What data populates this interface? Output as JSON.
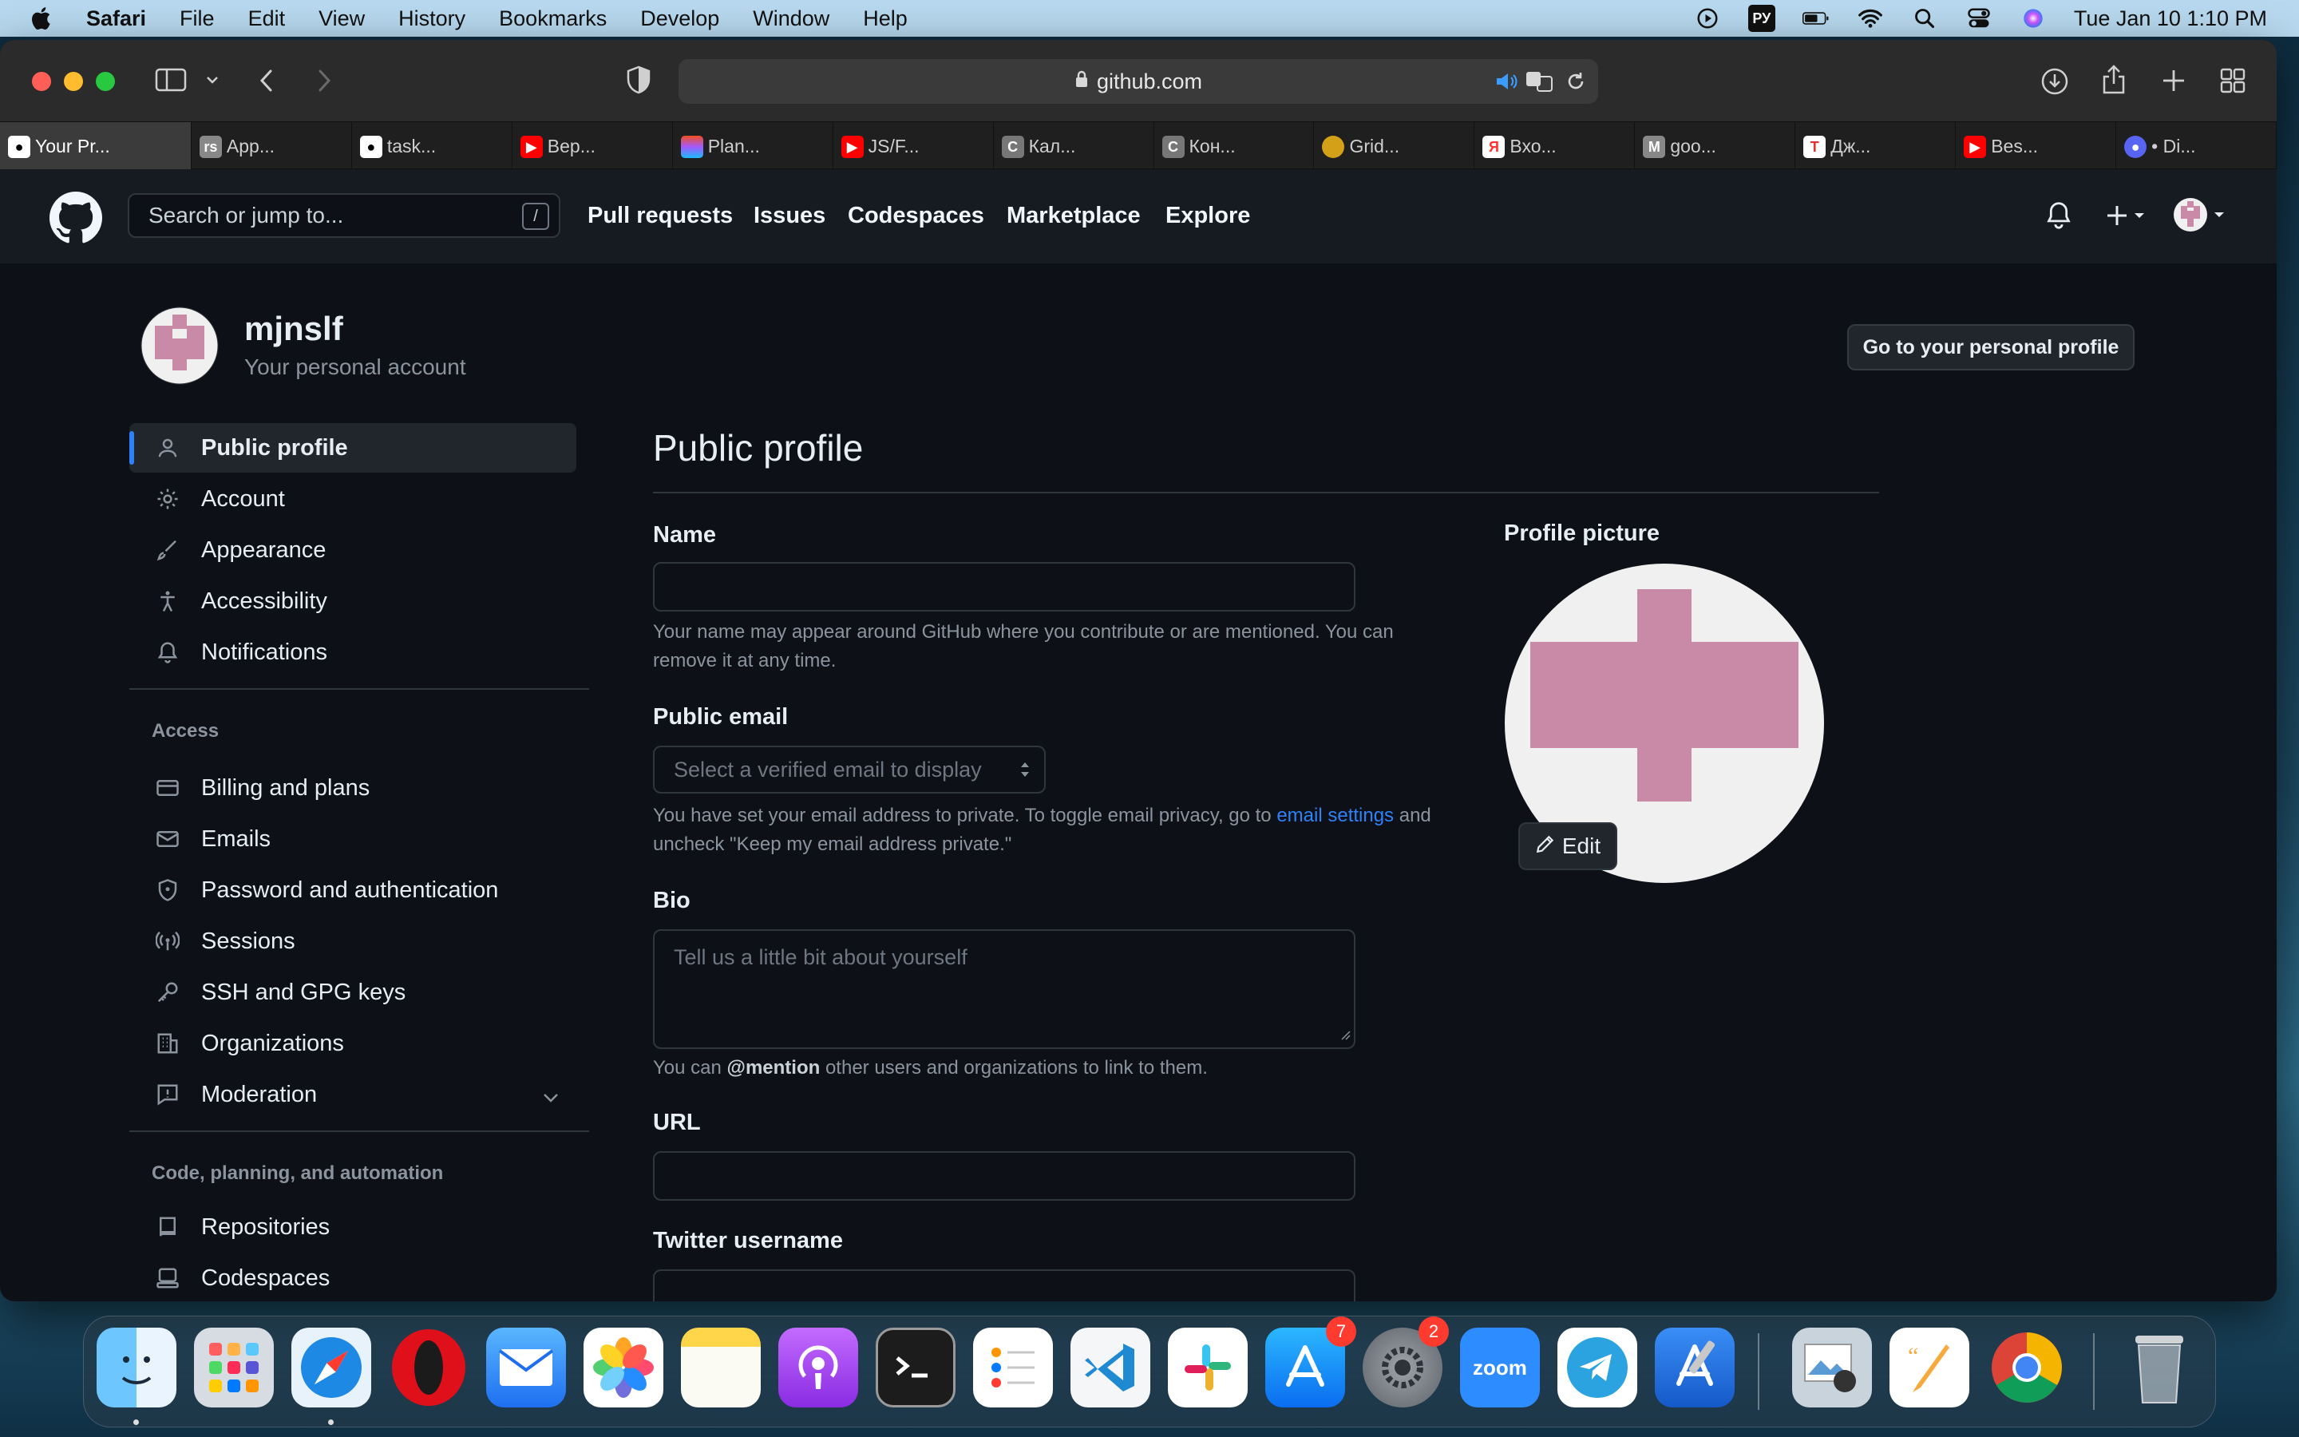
{
  "menubar": {
    "app_name": "Safari",
    "items": [
      "File",
      "Edit",
      "View",
      "History",
      "Bookmarks",
      "Develop",
      "Window",
      "Help"
    ],
    "keyboard_layout": "РУ",
    "clock": "Tue Jan 10  1:10 PM"
  },
  "browser": {
    "url": "github.com",
    "tabs": [
      {
        "label": "Your Pr...",
        "icon": "github",
        "color": "#ffffff"
      },
      {
        "label": "App...",
        "icon": "rs",
        "color": "#888888"
      },
      {
        "label": "task...",
        "icon": "github",
        "color": "#ffffff"
      },
      {
        "label": "Вер...",
        "icon": "youtube",
        "color": "#ff0000"
      },
      {
        "label": "Plan...",
        "icon": "figma",
        "color": "#a259ff"
      },
      {
        "label": "JS/F...",
        "icon": "youtube",
        "color": "#ff0000"
      },
      {
        "label": "Кал...",
        "icon": "c",
        "color": "#777777"
      },
      {
        "label": "Кон...",
        "icon": "c",
        "color": "#777777"
      },
      {
        "label": "Grid...",
        "icon": "medal",
        "color": "#d4a017"
      },
      {
        "label": "Вхо...",
        "icon": "yandex",
        "color": "#ff3333"
      },
      {
        "label": "goo...",
        "icon": "m",
        "color": "#888888"
      },
      {
        "label": "Дж...",
        "icon": "t",
        "color": "#e03030"
      },
      {
        "label": "Bes...",
        "icon": "youtube",
        "color": "#ff0000"
      },
      {
        "label": "• Di...",
        "icon": "discord",
        "color": "#5865f2"
      }
    ]
  },
  "header": {
    "search_placeholder": "Search or jump to...",
    "search_shortcut": "/",
    "nav": [
      "Pull requests",
      "Issues",
      "Codespaces",
      "Marketplace",
      "Explore"
    ]
  },
  "account": {
    "username": "mjnslf",
    "subtitle": "Your personal account",
    "profile_button": "Go to your personal profile"
  },
  "sidebar": {
    "items": [
      {
        "label": "Public profile",
        "icon": "person-icon"
      },
      {
        "label": "Account",
        "icon": "gear-icon"
      },
      {
        "label": "Appearance",
        "icon": "paintbrush-icon"
      },
      {
        "label": "Accessibility",
        "icon": "accessibility-icon"
      },
      {
        "label": "Notifications",
        "icon": "bell-icon"
      }
    ],
    "access_label": "Access",
    "access_items": [
      {
        "label": "Billing and plans",
        "icon": "credit-card-icon"
      },
      {
        "label": "Emails",
        "icon": "mail-icon"
      },
      {
        "label": "Password and authentication",
        "icon": "shield-icon"
      },
      {
        "label": "Sessions",
        "icon": "broadcast-icon"
      },
      {
        "label": "SSH and GPG keys",
        "icon": "key-icon"
      },
      {
        "label": "Organizations",
        "icon": "organization-icon"
      },
      {
        "label": "Moderation",
        "icon": "report-icon"
      }
    ],
    "code_label": "Code, planning, and automation",
    "code_items": [
      {
        "label": "Repositories",
        "icon": "repo-icon"
      },
      {
        "label": "Codespaces",
        "icon": "codespaces-icon"
      }
    ]
  },
  "main": {
    "title": "Public profile",
    "name": {
      "label": "Name",
      "value": "",
      "hint": "Your name may appear around GitHub where you contribute or are mentioned. You can remove it at any time."
    },
    "public_email": {
      "label": "Public email",
      "placeholder": "Select a verified email to display",
      "hint_before": "You have set your email address to private. To toggle email privacy, go to",
      "hint_link": "email settings",
      "hint_after": "and uncheck \"Keep my email address private.\""
    },
    "bio": {
      "label": "Bio",
      "placeholder": "Tell us a little bit about yourself",
      "hint_before": "You can",
      "hint_mention": "@mention",
      "hint_after": "other users and organizations to link to them."
    },
    "url": {
      "label": "URL",
      "value": ""
    },
    "twitter": {
      "label": "Twitter username",
      "value": ""
    },
    "profile_picture": {
      "label": "Profile picture",
      "edit_label": "Edit",
      "avatar_color": "#c98aa7"
    }
  },
  "dock": {
    "apps": [
      {
        "name": "Finder",
        "icon": "finder-icon"
      },
      {
        "name": "Launchpad",
        "icon": "launchpad-icon"
      },
      {
        "name": "Safari",
        "icon": "safari-icon"
      },
      {
        "name": "Opera",
        "icon": "opera-icon"
      },
      {
        "name": "Mail",
        "icon": "mail-app-icon"
      },
      {
        "name": "Photos",
        "icon": "photos-icon"
      },
      {
        "name": "Notes",
        "icon": "notes-icon"
      },
      {
        "name": "Podcasts",
        "icon": "podcasts-icon"
      },
      {
        "name": "Terminal",
        "icon": "terminal-icon"
      },
      {
        "name": "Reminders",
        "icon": "reminders-icon"
      },
      {
        "name": "VS Code",
        "icon": "vscode-icon"
      },
      {
        "name": "Slack",
        "icon": "slack-icon"
      },
      {
        "name": "App Store",
        "icon": "app-store-icon",
        "badge": "7"
      },
      {
        "name": "System Preferences",
        "icon": "system-preferences-icon",
        "badge": "2"
      },
      {
        "name": "Zoom",
        "icon": "zoom-icon",
        "label": "zoom"
      },
      {
        "name": "Telegram",
        "icon": "telegram-icon"
      },
      {
        "name": "Xcode",
        "icon": "xcode-icon"
      },
      {
        "name": "Preview",
        "icon": "preview-icon"
      },
      {
        "name": "Pages",
        "icon": "pages-icon"
      },
      {
        "name": "Chrome",
        "icon": "chrome-icon"
      },
      {
        "name": "Trash",
        "icon": "trash-icon"
      }
    ]
  }
}
